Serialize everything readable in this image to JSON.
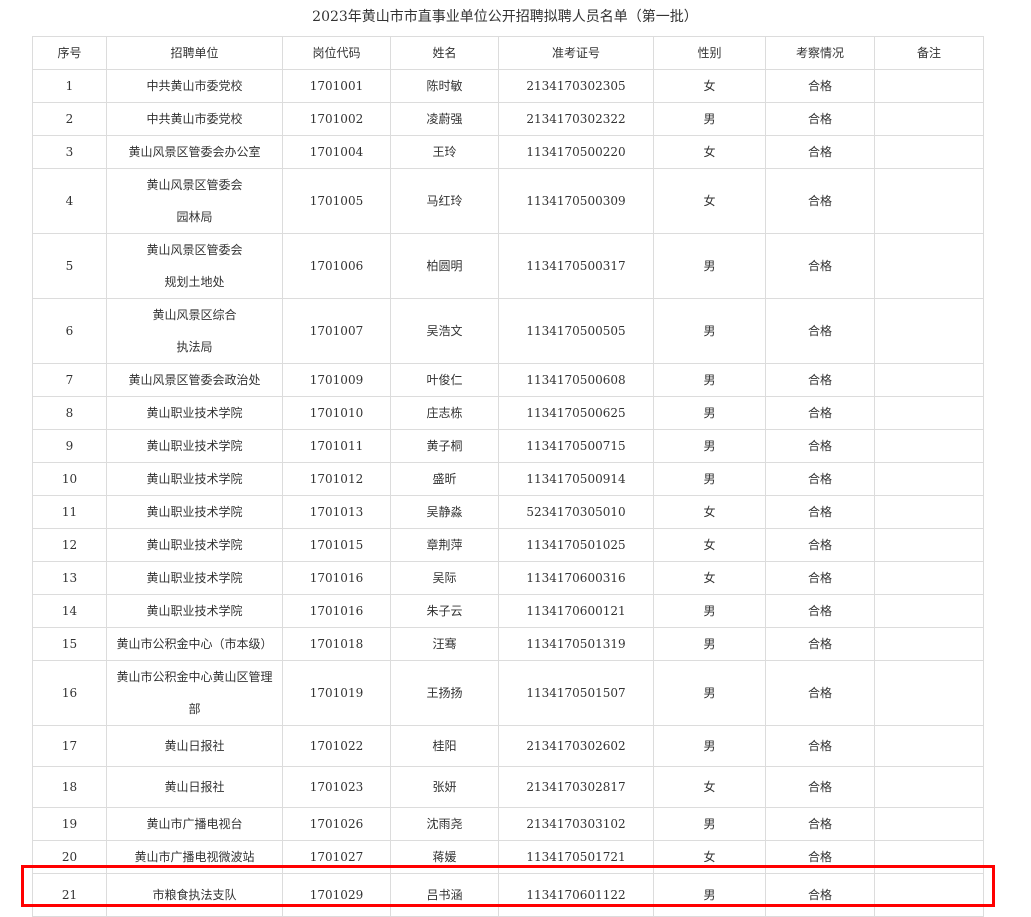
{
  "title": "2023年黄山市市直事业单位公开招聘拟聘人员名单（第一批）",
  "headers": [
    "序号",
    "招聘单位",
    "岗位代码",
    "姓名",
    "准考证号",
    "性别",
    "考察情况",
    "备注"
  ],
  "rows": [
    {
      "no": "1",
      "unit": [
        "中共黄山市委党校"
      ],
      "code": "1701001",
      "name": "陈时敏",
      "ticket": "2134170302305",
      "gender": "女",
      "status": "合格",
      "note": ""
    },
    {
      "no": "2",
      "unit": [
        "中共黄山市委党校"
      ],
      "code": "1701002",
      "name": "凌蔚强",
      "ticket": "2134170302322",
      "gender": "男",
      "status": "合格",
      "note": ""
    },
    {
      "no": "3",
      "unit": [
        "黄山风景区管委会办公室"
      ],
      "code": "1701004",
      "name": "王玲",
      "ticket": "1134170500220",
      "gender": "女",
      "status": "合格",
      "note": ""
    },
    {
      "no": "4",
      "unit": [
        "黄山风景区管委会",
        "园林局"
      ],
      "code": "1701005",
      "name": "马红玲",
      "ticket": "1134170500309",
      "gender": "女",
      "status": "合格",
      "note": ""
    },
    {
      "no": "5",
      "unit": [
        "黄山风景区管委会",
        "规划土地处"
      ],
      "code": "1701006",
      "name": "柏圆明",
      "ticket": "1134170500317",
      "gender": "男",
      "status": "合格",
      "note": ""
    },
    {
      "no": "6",
      "unit": [
        "黄山风景区综合",
        "执法局"
      ],
      "code": "1701007",
      "name": "吴浩文",
      "ticket": "1134170500505",
      "gender": "男",
      "status": "合格",
      "note": ""
    },
    {
      "no": "7",
      "unit": [
        "黄山风景区管委会政治处"
      ],
      "code": "1701009",
      "name": "叶俊仁",
      "ticket": "1134170500608",
      "gender": "男",
      "status": "合格",
      "note": ""
    },
    {
      "no": "8",
      "unit": [
        "黄山职业技术学院"
      ],
      "code": "1701010",
      "name": "庄志栋",
      "ticket": "1134170500625",
      "gender": "男",
      "status": "合格",
      "note": ""
    },
    {
      "no": "9",
      "unit": [
        "黄山职业技术学院"
      ],
      "code": "1701011",
      "name": "黄子桐",
      "ticket": "1134170500715",
      "gender": "男",
      "status": "合格",
      "note": ""
    },
    {
      "no": "10",
      "unit": [
        "黄山职业技术学院"
      ],
      "code": "1701012",
      "name": "盛昕",
      "ticket": "1134170500914",
      "gender": "男",
      "status": "合格",
      "note": ""
    },
    {
      "no": "11",
      "unit": [
        "黄山职业技术学院"
      ],
      "code": "1701013",
      "name": "吴静淼",
      "ticket": "5234170305010",
      "gender": "女",
      "status": "合格",
      "note": ""
    },
    {
      "no": "12",
      "unit": [
        "黄山职业技术学院"
      ],
      "code": "1701015",
      "name": "章荆萍",
      "ticket": "1134170501025",
      "gender": "女",
      "status": "合格",
      "note": ""
    },
    {
      "no": "13",
      "unit": [
        "黄山职业技术学院"
      ],
      "code": "1701016",
      "name": "吴际",
      "ticket": "1134170600316",
      "gender": "女",
      "status": "合格",
      "note": ""
    },
    {
      "no": "14",
      "unit": [
        "黄山职业技术学院"
      ],
      "code": "1701016",
      "name": "朱子云",
      "ticket": "1134170600121",
      "gender": "男",
      "status": "合格",
      "note": ""
    },
    {
      "no": "15",
      "unit": [
        "黄山市公积金中心（市本级）"
      ],
      "code": "1701018",
      "name": "汪骞",
      "ticket": "1134170501319",
      "gender": "男",
      "status": "合格",
      "note": ""
    },
    {
      "no": "16",
      "unit": [
        "黄山市公积金中心黄山区管理",
        "部"
      ],
      "code": "1701019",
      "name": "王扬扬",
      "ticket": "1134170501507",
      "gender": "男",
      "status": "合格",
      "note": ""
    },
    {
      "no": "17",
      "unit": [
        "黄山日报社"
      ],
      "code": "1701022",
      "name": "桂阳",
      "ticket": "2134170302602",
      "gender": "男",
      "status": "合格",
      "note": ""
    },
    {
      "no": "18",
      "unit": [
        "黄山日报社"
      ],
      "code": "1701023",
      "name": "张妍",
      "ticket": "2134170302817",
      "gender": "女",
      "status": "合格",
      "note": ""
    },
    {
      "no": "19",
      "unit": [
        "黄山市广播电视台"
      ],
      "code": "1701026",
      "name": "沈雨尧",
      "ticket": "2134170303102",
      "gender": "男",
      "status": "合格",
      "note": ""
    },
    {
      "no": "20",
      "unit": [
        "黄山市广播电视微波站"
      ],
      "code": "1701027",
      "name": "蒋媛",
      "ticket": "1134170501721",
      "gender": "女",
      "status": "合格",
      "note": ""
    },
    {
      "no": "21",
      "unit": [
        "市粮食执法支队"
      ],
      "code": "1701029",
      "name": "吕书涵",
      "ticket": "1134170601122",
      "gender": "男",
      "status": "合格",
      "note": ""
    }
  ],
  "highlight_color": "#ff0000"
}
